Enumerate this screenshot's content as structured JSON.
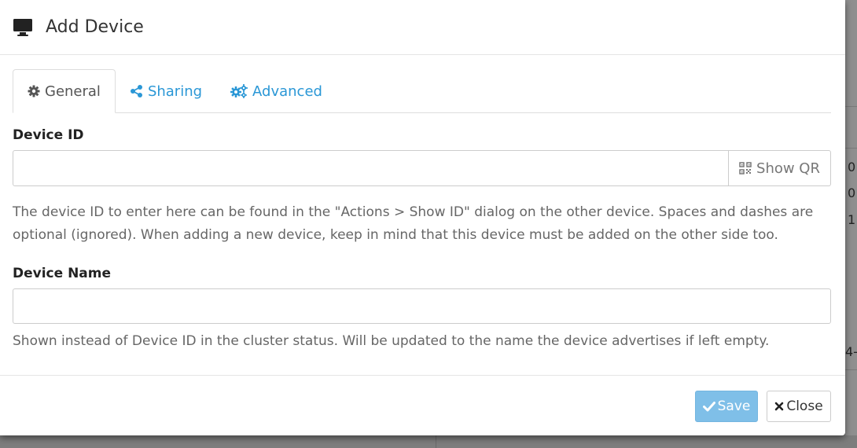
{
  "modal": {
    "title": "Add Device",
    "title_icon": "monitor-icon"
  },
  "tabs": [
    {
      "label": "General",
      "icon": "gear-icon",
      "active": true
    },
    {
      "label": "Sharing",
      "icon": "share-icon",
      "active": false
    },
    {
      "label": "Advanced",
      "icon": "gears-icon",
      "active": false
    }
  ],
  "device_id": {
    "label": "Device ID",
    "value": "",
    "show_qr_label": "Show QR",
    "help": "The device ID to enter here can be found in the \"Actions > Show ID\" dialog on the other device. Spaces and dashes are optional (ignored). When adding a new device, keep in mind that this device must be added on the other side too."
  },
  "device_name": {
    "label": "Device Name",
    "value": "",
    "help": "Shown instead of Device ID in the cluster status. Will be updated to the name the device advertises if left empty."
  },
  "footer": {
    "save_label": "Save",
    "close_label": "Close"
  },
  "background": {
    "fragments": [
      "0",
      "0",
      "1",
      "4-"
    ]
  },
  "colors": {
    "link": "#2a97d6",
    "save_button": "#7fbfe8"
  }
}
